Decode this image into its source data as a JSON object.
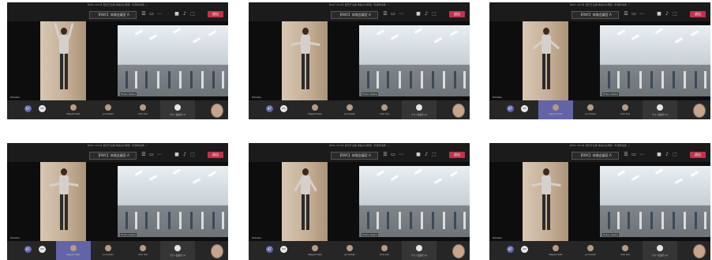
{
  "meeting": {
    "window_title": "【RWC 2019】観光庁主催 体操のお時間（外部参加者…）",
    "meeting_name": "【RWC】体操会議室 A",
    "leave_label": "退出",
    "self_initials": "BT",
    "guest_initials": "RB"
  },
  "screens": [
    {
      "left_label": "Shinobu",
      "right_label": "Hideo Osaka",
      "highlight": false,
      "participants": [
        "Megumi Sato",
        "Jun Suzuki",
        "Yumi Ono",
        "ゲスト会議室 (1)"
      ]
    },
    {
      "left_label": "Shinobu",
      "right_label": "Hideo Osaka",
      "highlight": false,
      "participants": [
        "Megumi Sato",
        "Jun Suzuki",
        "Yumi Ono",
        "ゲスト会議室 (1)"
      ]
    },
    {
      "left_label": "Shinobu",
      "right_label": "Hideo Osaka",
      "highlight": true,
      "participants": [
        "Megumi Sato",
        "Jun Suzuki",
        "Yumi Ono",
        "ゲスト会議室 (1)"
      ]
    },
    {
      "left_label": "Shinobu",
      "right_label": "Hideo Osaka",
      "highlight": true,
      "participants": [
        "Megumi Sato",
        "Jun Suzuki",
        "Yumi Ono",
        "ゲスト会議室 (1)"
      ]
    },
    {
      "left_label": "Shinobu",
      "right_label": "Hideo Osaka",
      "highlight": false,
      "participants": [
        "Megumi Sato",
        "Jun Suzuki",
        "Yumi Ono",
        "ゲスト会議室 (1)"
      ]
    },
    {
      "left_label": "Shinobu",
      "right_label": "Hideo Osaka",
      "highlight": false,
      "participants": [
        "Megumi Sato",
        "Jun Suzuki",
        "Yumi Ono",
        "ゲスト会議室 (1)"
      ]
    }
  ],
  "icons": [
    "camera-icon",
    "mic-icon",
    "share-icon",
    "more-icon",
    "people-icon"
  ],
  "colors": {
    "leave": "#c4314b",
    "accent": "#6264a7"
  }
}
